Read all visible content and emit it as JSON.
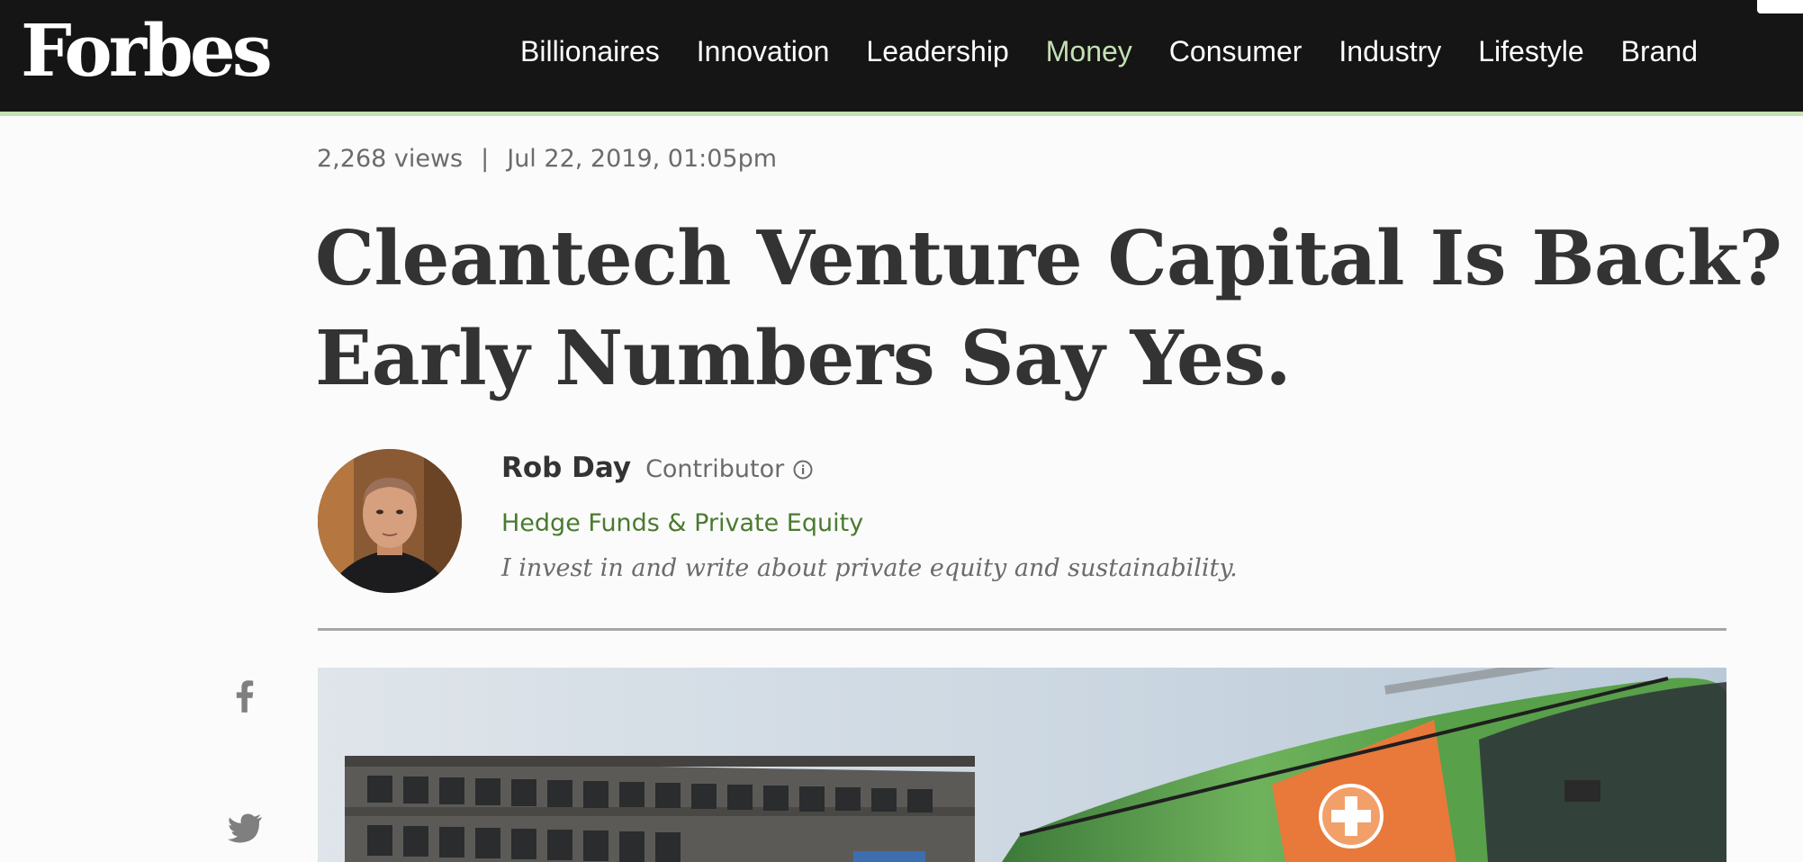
{
  "brand": {
    "logo_text": "Forbes",
    "colors": {
      "nav_bg": "#151515",
      "nav_accent": "#c5e0b4",
      "headline": "#333333",
      "channel_link": "#4a7a2e",
      "meta_text": "#6b6b6b"
    }
  },
  "nav": {
    "items": [
      {
        "label": "Billionaires",
        "active": false
      },
      {
        "label": "Innovation",
        "active": false
      },
      {
        "label": "Leadership",
        "active": false
      },
      {
        "label": "Money",
        "active": true
      },
      {
        "label": "Consumer",
        "active": false
      },
      {
        "label": "Industry",
        "active": false
      },
      {
        "label": "Lifestyle",
        "active": false
      },
      {
        "label": "Brand",
        "active": false
      }
    ]
  },
  "article": {
    "views": "2,268 views",
    "separator": "|",
    "date": "Jul 22, 2019, 01:05pm",
    "headline_line1": "Cleantech Venture Capital Is Back?",
    "headline_line2": "Early Numbers Say Yes."
  },
  "author": {
    "name": "Rob Day",
    "role": "Contributor",
    "role_icon": "info-icon",
    "channel": "Hedge Funds & Private Equity",
    "bio": "I invest in and write about private equity and sustainability."
  },
  "share": {
    "icons": [
      "facebook-icon",
      "twitter-icon"
    ]
  },
  "hero": {
    "subject": "electric bus in front of building"
  }
}
